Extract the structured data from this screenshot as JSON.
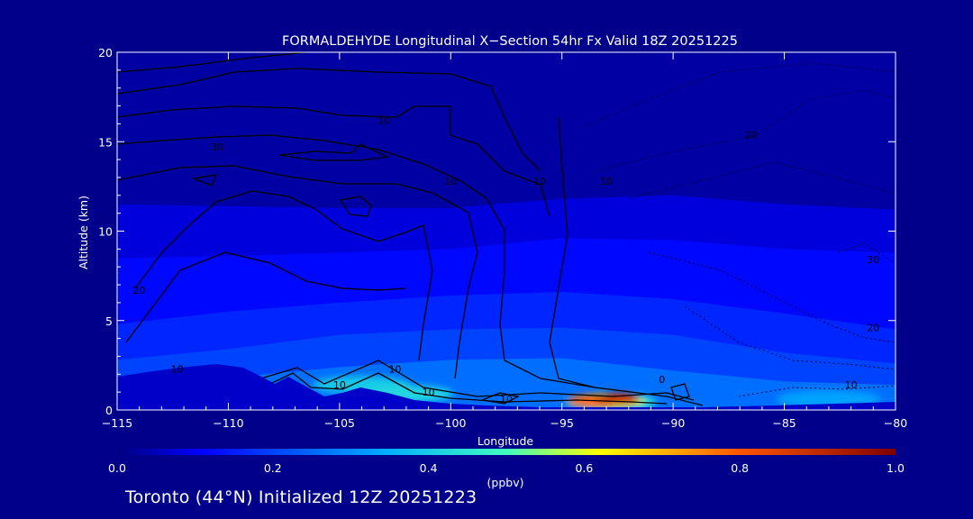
{
  "chart_data": {
    "type": "heatmap",
    "title": "FORMALDEHYDE Longitudinal X−Section 54hr  Fx Valid 18Z 20251225",
    "xlabel": "Longitude",
    "ylabel": "Altitude (km)",
    "xlim": [
      -115,
      -80
    ],
    "ylim": [
      0,
      20
    ],
    "x_ticks": [
      -115,
      -110,
      -105,
      -100,
      -95,
      -90,
      -85,
      -80
    ],
    "x_tick_labels": [
      "−115",
      "−110",
      "−105",
      "−100",
      "−95",
      "−90",
      "−85",
      "−80"
    ],
    "y_ticks": [
      0,
      5,
      10,
      15,
      20
    ],
    "y_tick_labels": [
      "0",
      "5",
      "10",
      "15",
      "20"
    ],
    "colorbar": {
      "min": 0.0,
      "max": 1.0,
      "ticks": [
        0.0,
        0.2,
        0.4,
        0.6,
        0.8,
        1.0
      ],
      "tick_labels": [
        "0.0",
        "0.2",
        "0.4",
        "0.6",
        "0.8",
        "1.0"
      ],
      "label": "(ppbv)",
      "colormap": "jet"
    },
    "field_layers": [
      {
        "lon": [
          -115,
          -110,
          -105,
          -100,
          -95,
          -90,
          -85,
          -80
        ],
        "top_km": [
          20,
          20,
          20,
          20,
          20,
          20,
          20,
          20
        ],
        "value": 0.03
      },
      {
        "lon": [
          -115,
          -110,
          -105,
          -100,
          -95,
          -90,
          -85,
          -80
        ],
        "top_km": [
          11.5,
          11.4,
          11.3,
          11.3,
          11.8,
          12.0,
          11.5,
          11.2
        ],
        "value": 0.08
      },
      {
        "lon": [
          -115,
          -110,
          -105,
          -100,
          -95,
          -90,
          -85,
          -80
        ],
        "top_km": [
          8.5,
          8.6,
          8.8,
          9.0,
          9.6,
          9.5,
          9.0,
          8.8
        ],
        "value": 0.12
      },
      {
        "lon": [
          -115,
          -110,
          -105,
          -100,
          -95,
          -90,
          -85,
          -80
        ],
        "top_km": [
          4.8,
          5.5,
          6.0,
          6.4,
          6.6,
          6.2,
          5.4,
          4.5
        ],
        "value": 0.16
      },
      {
        "lon": [
          -115,
          -110,
          -105,
          -100,
          -95,
          -90,
          -85,
          -80
        ],
        "top_km": [
          2.8,
          3.4,
          4.2,
          4.5,
          4.6,
          4.2,
          3.2,
          2.6
        ],
        "value": 0.2
      },
      {
        "lon": [
          -115,
          -110,
          -105,
          -100,
          -95,
          -90,
          -85,
          -80
        ],
        "top_km": [
          1.6,
          1.8,
          2.4,
          2.8,
          2.9,
          2.2,
          1.6,
          1.4
        ],
        "value": 0.26
      }
    ],
    "hotspots": [
      {
        "lon": -92.8,
        "alt_km": 0.45,
        "value": 0.45
      },
      {
        "lon": -93.0,
        "alt_km": 0.5,
        "value": 0.6
      },
      {
        "lon": -93.5,
        "alt_km": 0.5,
        "value": 0.78
      },
      {
        "lon": -92.5,
        "alt_km": 0.6,
        "value": 0.88
      },
      {
        "lon": -104.0,
        "alt_km": 1.4,
        "value": 0.4
      },
      {
        "lon": -102.0,
        "alt_km": 0.9,
        "value": 0.42
      },
      {
        "lon": -83.0,
        "alt_km": 0.6,
        "value": 0.33
      }
    ],
    "contour_labels": [
      {
        "text": "10",
        "lon": -103.0,
        "alt_km": 16.0
      },
      {
        "text": "30",
        "lon": -110.5,
        "alt_km": 14.5
      },
      {
        "text": "10",
        "lon": -100.0,
        "alt_km": 12.6
      },
      {
        "text": "10",
        "lon": -96.0,
        "alt_km": 12.6
      },
      {
        "text": "10",
        "lon": -93.0,
        "alt_km": 12.6
      },
      {
        "text": "20",
        "lon": -114.0,
        "alt_km": 6.5
      },
      {
        "text": "20",
        "lon": -86.5,
        "alt_km": 15.2
      },
      {
        "text": "30",
        "lon": -81.0,
        "alt_km": 8.2
      },
      {
        "text": "20",
        "lon": -81.0,
        "alt_km": 4.4
      },
      {
        "text": "10",
        "lon": -82.0,
        "alt_km": 1.2
      },
      {
        "text": "10",
        "lon": -112.3,
        "alt_km": 2.1
      },
      {
        "text": "10",
        "lon": -105.0,
        "alt_km": 1.2
      },
      {
        "text": "10",
        "lon": -102.5,
        "alt_km": 2.1
      },
      {
        "text": "10",
        "lon": -101.0,
        "alt_km": 0.8
      },
      {
        "text": "10",
        "lon": -97.5,
        "alt_km": 0.4
      },
      {
        "text": "0",
        "lon": -90.5,
        "alt_km": 1.5
      }
    ]
  },
  "footer_text": "Toronto (44°N) Initialized 12Z 20251223",
  "colors": {
    "background": "#00008b",
    "axis_frame": "#ffffff",
    "contour": "#000000",
    "terrain": "#0000c8"
  }
}
